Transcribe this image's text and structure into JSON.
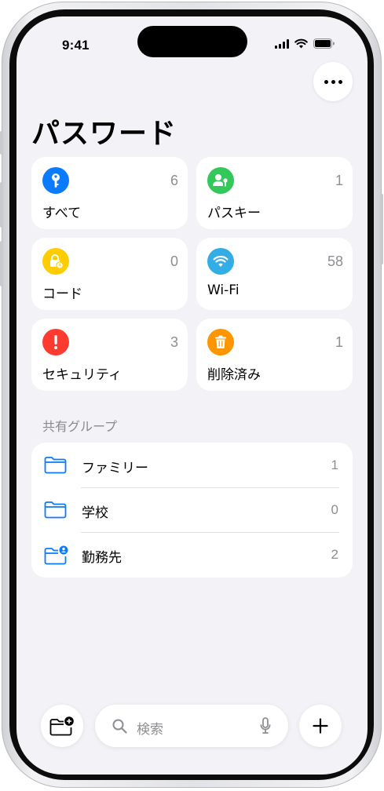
{
  "status_bar": {
    "time": "9:41"
  },
  "header": {
    "title": "パスワード",
    "more_icon": "ellipsis-icon"
  },
  "categories": [
    {
      "label": "すべて",
      "count": "6",
      "icon": "key-icon",
      "color": "#0a7aff"
    },
    {
      "label": "パスキー",
      "count": "1",
      "icon": "person-key-icon",
      "color": "#34c759"
    },
    {
      "label": "コード",
      "count": "0",
      "icon": "lock-clock-icon",
      "color": "#ffcc00"
    },
    {
      "label": "Wi-Fi",
      "count": "58",
      "icon": "wifi-icon",
      "color": "#32ade6"
    },
    {
      "label": "セキュリティ",
      "count": "3",
      "icon": "exclamation-icon",
      "color": "#ff3b30"
    },
    {
      "label": "削除済み",
      "count": "1",
      "icon": "trash-icon",
      "color": "#ff9500"
    }
  ],
  "shared_groups": {
    "header": "共有グループ",
    "items": [
      {
        "label": "ファミリー",
        "count": "1",
        "icon": "folder-icon"
      },
      {
        "label": "学校",
        "count": "0",
        "icon": "folder-icon"
      },
      {
        "label": "勤務先",
        "count": "2",
        "icon": "folder-person-icon"
      }
    ]
  },
  "bottom_bar": {
    "search_placeholder": "検索",
    "new_group_icon": "folder-plus-icon",
    "add_icon": "plus-icon",
    "mic_icon": "mic-icon",
    "search_icon": "search-icon"
  },
  "accent_color": "#0a7aff"
}
